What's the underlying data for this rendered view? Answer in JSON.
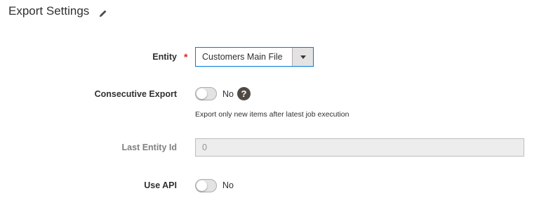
{
  "section": {
    "title": "Export Settings",
    "edit_icon": "pencil-icon"
  },
  "entity": {
    "label": "Entity",
    "required_mark": "*",
    "selected_value": "Customers Main File",
    "arrow_icon": "chevron-down-icon"
  },
  "consecutive_export": {
    "label": "Consecutive Export",
    "toggle_state": "No",
    "help_icon_text": "?",
    "note": "Export only new items after latest job execution"
  },
  "last_entity_id": {
    "label": "Last Entity Id",
    "value": "0"
  },
  "use_api": {
    "label": "Use API",
    "toggle_state": "No"
  },
  "colors": {
    "focus_border": "#007bdb",
    "required": "#e22626",
    "help_bg": "#514943"
  }
}
